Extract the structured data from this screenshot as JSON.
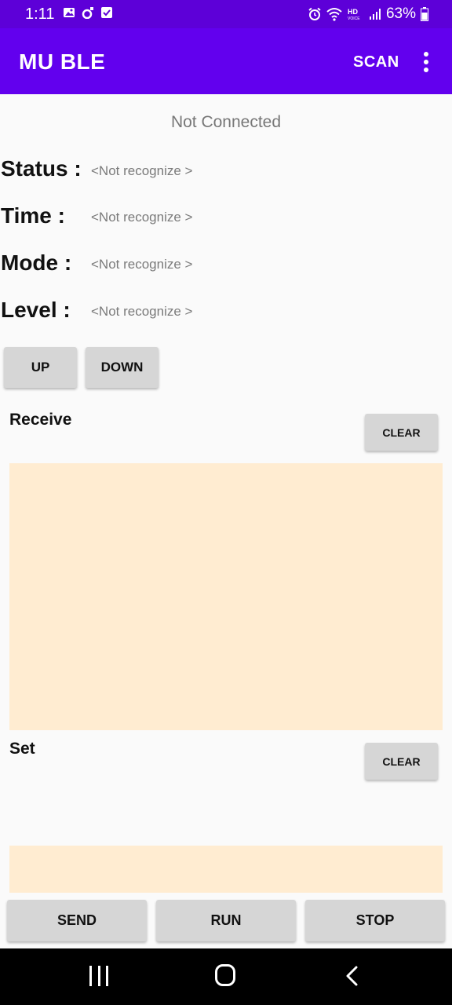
{
  "status_bar": {
    "time": "1:11",
    "battery": "63%"
  },
  "app_bar": {
    "title": "MU BLE",
    "scan_label": "SCAN",
    "more_icon": "more-vert-icon"
  },
  "connection_status": "Not Connected",
  "fields": [
    {
      "label": "Status :",
      "value": "<Not recognize >"
    },
    {
      "label": "Time :",
      "value": "<Not recognize >"
    },
    {
      "label": "Mode :",
      "value": "<Not recognize >"
    },
    {
      "label": "Level :",
      "value": "<Not recognize >"
    }
  ],
  "level_buttons": {
    "up": "UP",
    "down": "DOWN"
  },
  "receive": {
    "label": "Receive",
    "clear": "CLEAR"
  },
  "set": {
    "label": "Set",
    "clear": "CLEAR"
  },
  "bottom_buttons": {
    "send": "SEND",
    "run": "RUN",
    "stop": "STOP"
  },
  "colors": {
    "app_bar": "#6200ee",
    "status_bar": "#5d00d8",
    "text_area": "#ffecd1",
    "button": "#d6d6d6"
  }
}
